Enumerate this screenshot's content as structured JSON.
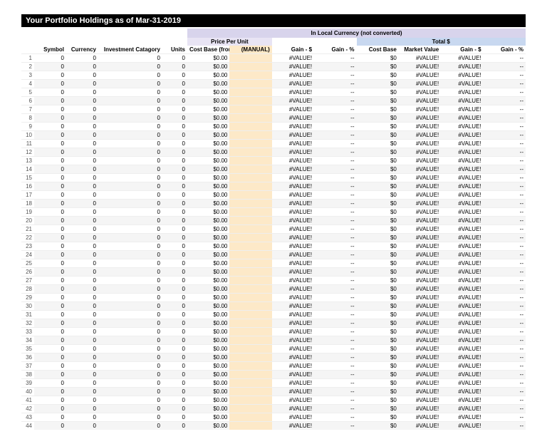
{
  "title": "Your Portfolio Holdings as of Mar-31-2019",
  "headers": {
    "local_currency": "In Local Currency (not converted)",
    "price_per_unit": "Price Per Unit",
    "total": "Total $",
    "symbol": "Symbol",
    "currency": "Currency",
    "category": "Investment Catagory",
    "units": "Units",
    "cost_base_google": "Cost Base (from Google)",
    "manual": "(MANUAL)",
    "gain_s": "Gain - $",
    "gain_p": "Gain - %",
    "cost_base": "Cost Base",
    "market_value": "Market Value"
  },
  "row_defaults": {
    "symbol": "0",
    "currency": "0",
    "category": "0",
    "units": "0",
    "cost_base_google": "$0.00",
    "manual": "",
    "gain_s": "#VALUE!",
    "gain_p": "--",
    "cost_base2": "$0",
    "market_value": "#VALUE!",
    "gain_s2": "#VALUE!",
    "gain_p2": "--"
  },
  "row_count": 44
}
